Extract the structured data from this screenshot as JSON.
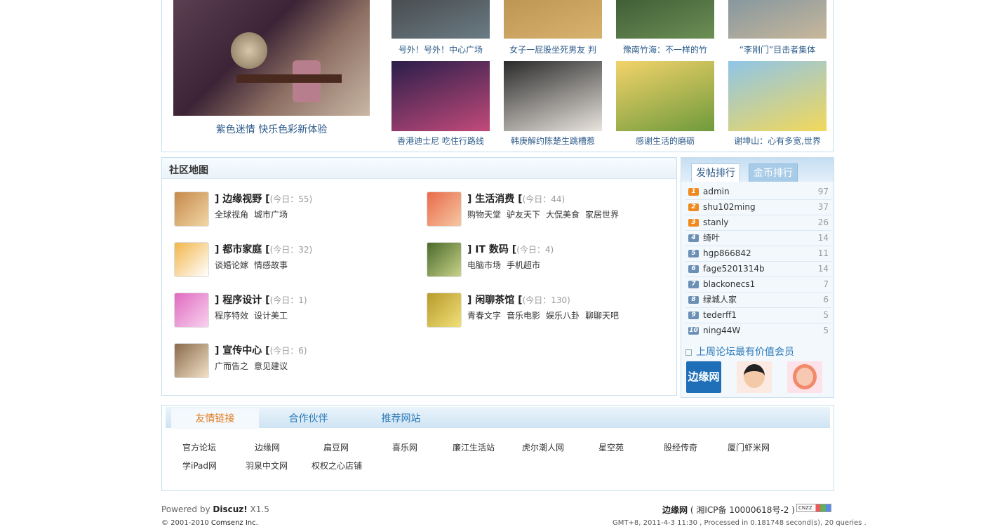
{
  "photos": {
    "big_caption": "紫色迷情 快乐色彩新体验",
    "grid": [
      {
        "caption": "号外！号外！中心广场",
        "colors": [
          "#3a3a3a",
          "#6b7b84"
        ]
      },
      {
        "caption": "女子一屁股坐死男友 判",
        "colors": [
          "#b48a4a",
          "#d7b26d"
        ]
      },
      {
        "caption": "豫南竹海：不一样的竹",
        "colors": [
          "#2f4a2a",
          "#6c8f55"
        ]
      },
      {
        "caption": "“李刚门”目击者集体",
        "colors": [
          "#6a8aa2",
          "#c8b79a"
        ]
      },
      {
        "caption": "香港迪士尼 吃住行路线",
        "colors": [
          "#2a1e4a",
          "#c24a7a"
        ]
      },
      {
        "caption": "韩庚解约陈楚生跳槽惹",
        "colors": [
          "#2a2a2a",
          "#e9e4de"
        ]
      },
      {
        "caption": "感谢生活的磨砺",
        "colors": [
          "#f3d36a",
          "#6f9a3c"
        ]
      },
      {
        "caption": "谢坤山：心有多宽,世界",
        "colors": [
          "#8fc5e8",
          "#f2d85a"
        ]
      }
    ]
  },
  "community_map": {
    "title": "社区地图",
    "forums": [
      {
        "name": "边缘视野",
        "today": "55",
        "subs": [
          "全球视角",
          "城市广场"
        ],
        "colors": [
          "#c6894a",
          "#f1d6a6"
        ]
      },
      {
        "name": "生活消费",
        "today": "44",
        "subs": [
          "购物天堂",
          "驴友天下",
          "大侃美食",
          "家居世界"
        ],
        "colors": [
          "#e96a4a",
          "#f6c7a2"
        ]
      },
      {
        "name": "都市家庭",
        "today": "32",
        "subs": [
          "谈婚论嫁",
          "情感故事"
        ],
        "colors": [
          "#f2b64a",
          "#ffffff"
        ]
      },
      {
        "name": "IT 数码",
        "today": "4",
        "subs": [
          "电脑市场",
          "手机超市"
        ],
        "colors": [
          "#4a6a2a",
          "#c9d38a"
        ]
      },
      {
        "name": "程序设计",
        "today": "1",
        "subs": [
          "程序特效",
          "设计美工"
        ],
        "colors": [
          "#e06ac0",
          "#f8d2ef"
        ]
      },
      {
        "name": "闲聊茶馆",
        "today": "130",
        "subs": [
          "青春文字",
          "音乐电影",
          "娱乐八卦",
          "聊聊天吧"
        ],
        "colors": [
          "#b89a2a",
          "#f1e07a"
        ]
      },
      {
        "name": "宣传中心",
        "today": "6",
        "subs": [
          "广而告之",
          "意见建议"
        ],
        "colors": [
          "#8a6a4a",
          "#f2e2c8"
        ]
      }
    ],
    "today_prefix": "今日：",
    "bracket_left": "]",
    "bracket_open": "[",
    "bracket_close": ")"
  },
  "ranking": {
    "tab_active": "发帖排行",
    "tab_inactive": "金币排行",
    "rows": [
      {
        "rank": "1",
        "name": "admin",
        "count": "97",
        "color": "#f08a1e"
      },
      {
        "rank": "2",
        "name": "shu102ming",
        "count": "37",
        "color": "#f08a1e"
      },
      {
        "rank": "3",
        "name": "stanly",
        "count": "26",
        "color": "#f08a1e"
      },
      {
        "rank": "4",
        "name": "绮叶",
        "count": "14",
        "color": "#6b8fb5"
      },
      {
        "rank": "5",
        "name": "hgp866842",
        "count": "11",
        "color": "#6b8fb5"
      },
      {
        "rank": "6",
        "name": "fage5201314b",
        "count": "14",
        "color": "#6b8fb5"
      },
      {
        "rank": "7",
        "name": "blackonecs1",
        "count": "7",
        "color": "#6b8fb5"
      },
      {
        "rank": "8",
        "name": "绿城人家",
        "count": "6",
        "color": "#6b8fb5"
      },
      {
        "rank": "9",
        "name": "tederff1",
        "count": "5",
        "color": "#6b8fb5"
      },
      {
        "rank": "10",
        "name": "ning44W",
        "count": "5",
        "color": "#6b8fb5"
      }
    ],
    "weekly_title": "上周论坛最有价值会员",
    "weekly_first_logo_text": "边缘网"
  },
  "links": {
    "tabs": [
      "友情链接",
      "合作伙伴",
      "推荐网站"
    ],
    "items": [
      "官方论坛",
      "边缘网",
      "扁豆网",
      "喜乐网",
      "廉江生活站",
      "虎尔潮人网",
      "星空苑",
      "股经传奇",
      "厦门虾米网",
      "学iPad网",
      "羽泉中文网",
      "权权之心店铺"
    ]
  },
  "footer": {
    "powered_prefix": "Powered by ",
    "powered_brand": "Discuz!",
    "powered_version": " X1.5",
    "copyright_prefix": "© 2001-2010 ",
    "copyright_company": "Comsenz Inc.",
    "site_name": "边缘网",
    "icp": "( 湘ICP备  10000618号-2 )",
    "cnzz_badge": "CNZZ",
    "stats": "GMT+8, 2011-4-3 11:30 , Processed in 0.181748 second(s), 20 queries ."
  }
}
